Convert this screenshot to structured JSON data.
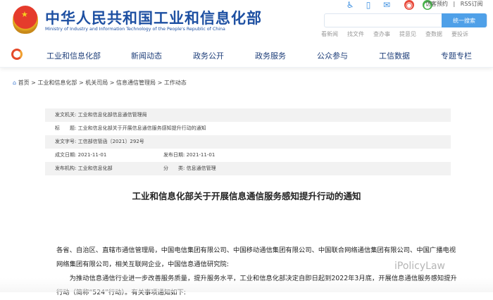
{
  "header": {
    "title_cn": "中华人民共和国工业和信息化部",
    "title_en": "Ministry of Industry and Information Technology of the People's Republic of China",
    "top_links": [
      "访客预约",
      "|",
      "RSS订阅"
    ],
    "search": {
      "placeholder": "",
      "button": "统一搜索"
    },
    "quick_links": [
      "看新闻",
      "找文件",
      "查办事",
      "提意见",
      "查数据",
      "要投诉"
    ]
  },
  "nav": [
    "工业和信息化部",
    "新闻动态",
    "政务公开",
    "政务服务",
    "公众参与",
    "工信数据",
    "专题专栏"
  ],
  "breadcrumb": [
    "首页",
    ">",
    "工业和信息化部",
    ">",
    "机关司局",
    ">",
    "信息通信管理局",
    ">",
    "工作动态"
  ],
  "meta": {
    "issuer_label": "发文机关:",
    "issuer": "工业和信息化部信息通信管理局",
    "title_label": "标　　题:",
    "title": "工业和信息化部关于开展信息通信服务感知提升行动的通知",
    "docno_label": "发文字号:",
    "docno": "工信部信管函〔2021〕292号",
    "written_label": "成文日期:",
    "written": "2021-11-01",
    "published_label": "发布日期:",
    "published": "2021-11-01",
    "org_label": "发布机构:",
    "org": "工业和信息化部",
    "category_label": "分　　类:",
    "category": "信息通信管理"
  },
  "article": {
    "title": "工业和信息化部关于开展信息通信服务感知提升行动的通知",
    "p1": "各省、自治区、直辖市通信管理局，中国电信集团有限公司、中国移动通信集团有限公司、中国联合网络通信集团有限公司、中国广播电视网络集团有限公司，相关互联网企业，中国信息通信研究院:",
    "p2": "为推动信息通信行业进一步改善服务质量，提升服务水平，工业和信息化部决定自即日起到2022年3月底，开展信息通信服务感知提升行动（简称“524”行动）。有关事项通知如下:"
  },
  "watermark": "iPolicyLaw"
}
